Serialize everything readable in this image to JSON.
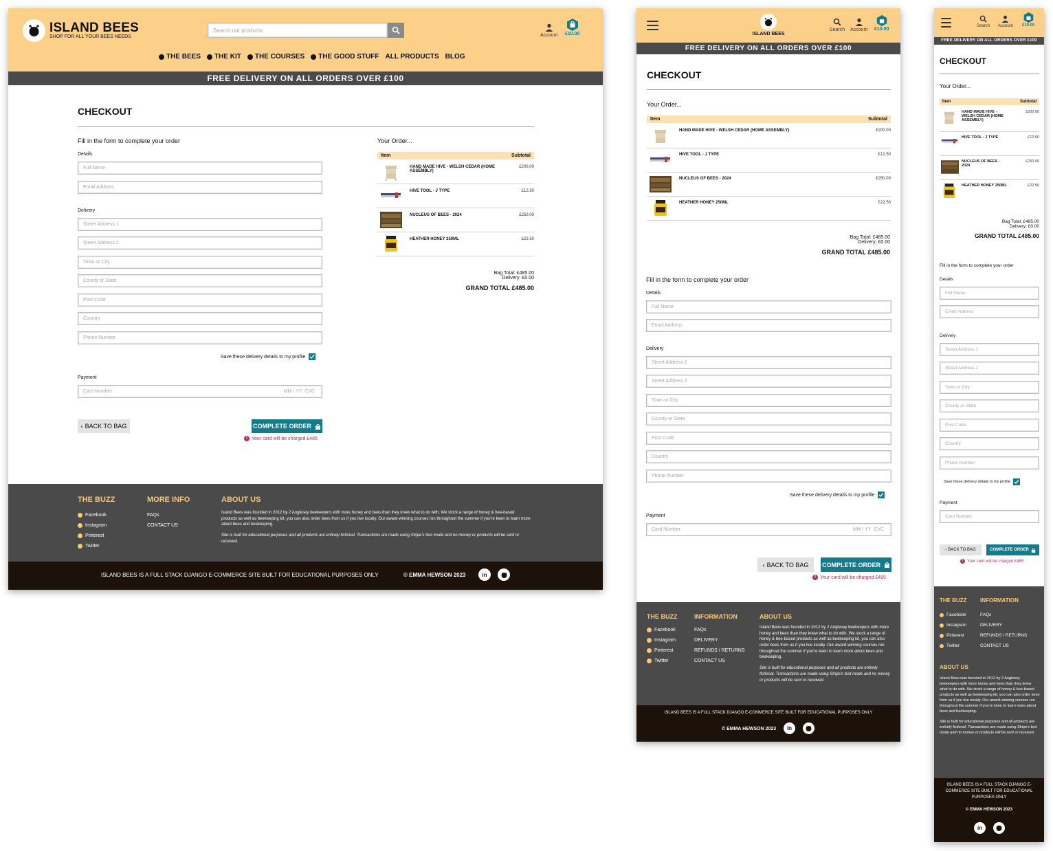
{
  "brand": {
    "name": "ISLAND BEES",
    "tagline": "SHOP FOR ALL YOUR BEES NEEDS"
  },
  "search": {
    "placeholder": "Search our products",
    "label": "Search"
  },
  "account": {
    "label": "Account"
  },
  "bag": {
    "total": "£10.00"
  },
  "nav": [
    "THE BEES",
    "THE KIT",
    "THE COURSES",
    "THE GOOD STUFF",
    "ALL PRODUCTS",
    "BLOG"
  ],
  "banner": "FREE DELIVERY ON ALL ORDERS OVER £100",
  "checkout": {
    "title": "CHECKOUT",
    "form_intro": "Fill in the form to complete your order",
    "details_label": "Details",
    "full_name": "Full Name",
    "email": "Email Address",
    "delivery_label": "Delivery",
    "street1": "Street Address 1",
    "street2": "Street Address 2",
    "town": "Town or City",
    "county": "County or State",
    "postcode": "Post Code",
    "country": "Country",
    "phone": "Phone Number",
    "save_details": "Save these delivery details to my profile",
    "payment_label": "Payment",
    "card_number": "Card Number",
    "card_meta": "MM / YY  CVC",
    "back_button": "BACK TO BAG",
    "complete_button": "COMPLETE ORDER",
    "charge_note": "Your card will be charged £485"
  },
  "order": {
    "heading": "Your Order...",
    "col_item": "Item",
    "col_subtotal": "Subtotal",
    "items": [
      {
        "name": "HAND MADE HIVE - WELSH CEDAR (HOME ASSEMBLY)",
        "price": "£200.00",
        "thumb": "hive"
      },
      {
        "name": "HIVE TOOL - J TYPE",
        "price": "£12.50",
        "thumb": "tool"
      },
      {
        "name": "NUCLEUS OF BEES - 2024",
        "price": "£250.00",
        "thumb": "frames"
      },
      {
        "name": "HEATHER HONEY 250ml",
        "price": "£22.50",
        "thumb": "honey"
      }
    ],
    "bag_total": "Bag Total: £485.00",
    "delivery": "Delivery: £0.00",
    "grand_total": "GRAND TOTAL £485.00"
  },
  "footer": {
    "buzz_title": "THE BUZZ",
    "buzz_links": [
      "Facebook",
      "Instagram",
      "Pinterest",
      "Twitter"
    ],
    "more_title": "MORE INFO",
    "more_links": [
      "FAQs",
      "CONTACT US"
    ],
    "info_title": "INFORMATION",
    "info_links": [
      "FAQs",
      "DELIVERY",
      "REFUNDS / RETURNS",
      "CONTACT US"
    ],
    "about_title": "ABOUT US",
    "about_text": "Island Bees was founded in 2012 by 2 Anglesey beekeepers with more honey and bees than they knew what to do with.  We stock a range of honey & bee-based products as well as beekeeping kit, you can also order bees from us if you live locally. Our award-winning courses run throughout the summer if you're keen to learn more about bees and beekeeping.",
    "about_note": "Site is built for educational purposes and all products are entirely fictional. Transactions are made using Stripe's test mode and no money or products will be sent or received.",
    "bottom_text": "ISLAND BEES IS A FULL STACK DJANGO E-COMMERCE SITE BUILT FOR EDUCATIONAL PURPOSES ONLY",
    "copyright": "© EMMA HEWSON 2023",
    "social": [
      "linkedin-icon",
      "github-icon"
    ]
  },
  "colors": {
    "header": "#fdd08a",
    "banner": "#4a4a4a",
    "accent": "#137b8c",
    "footer": "#4a4a4a",
    "footer_bottom": "#1c1209",
    "link_gold": "#fbc870",
    "warn": "#b03060"
  }
}
